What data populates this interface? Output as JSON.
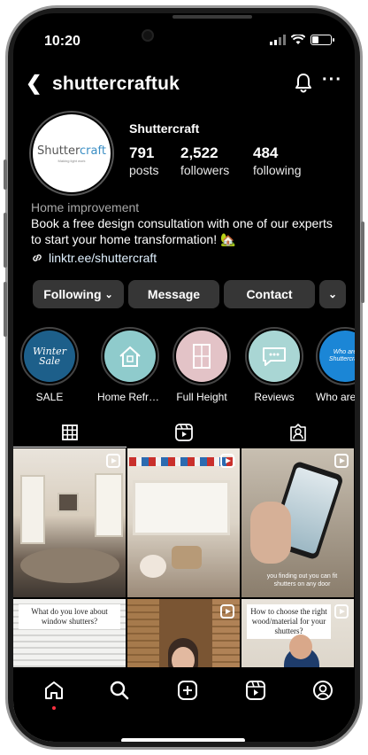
{
  "status": {
    "time": "10:20"
  },
  "header": {
    "username": "shuttercraftuk"
  },
  "profile": {
    "logo_text_a": "Shutter",
    "logo_text_b": "craft",
    "logo_tagline": "Making light work",
    "display_name": "Shuttercraft",
    "stats": [
      {
        "value": "791",
        "label": "posts"
      },
      {
        "value": "2,522",
        "label": "followers"
      },
      {
        "value": "484",
        "label": "following"
      }
    ],
    "category": "Home improvement",
    "bio": "Book a free design consultation with one of our experts to start your home transformation! 🏡",
    "link": "linktr.ee/shuttercraft"
  },
  "buttons": {
    "following": "Following",
    "message": "Message",
    "contact": "Contact"
  },
  "highlights": [
    {
      "label": "SALE",
      "title": "Winter Sale"
    },
    {
      "label": "Home Refre..."
    },
    {
      "label": "Full Height"
    },
    {
      "label": "Reviews"
    },
    {
      "label": "Who are",
      "title": "Who are Shuttercraft"
    }
  ],
  "posts": [
    {
      "kind": "dining room",
      "reel": true
    },
    {
      "kind": "bunting window",
      "reel": true
    },
    {
      "kind": "phone in hand",
      "reel": true,
      "overlay": "you finding out you can fit shutters on any door"
    },
    {
      "kind": "question card",
      "reel": false,
      "caption": "What do you love about window shutters?"
    },
    {
      "kind": "wooden shutters",
      "reel": true
    },
    {
      "kind": "question card",
      "reel": true,
      "caption": "How to choose the right wood/material for your shutters?"
    }
  ],
  "colors": {
    "accent_blue": "#3a8ec4",
    "notification_dot": "#ff3040",
    "highlight_bg": "#bfe0df"
  },
  "icons": [
    "back-chevron-icon",
    "bell-icon",
    "more-icon",
    "link-icon",
    "chevron-down-icon",
    "grid-icon",
    "reels-icon",
    "tagged-icon",
    "home-icon",
    "search-icon",
    "create-icon",
    "reels-nav-icon",
    "profile-icon"
  ]
}
